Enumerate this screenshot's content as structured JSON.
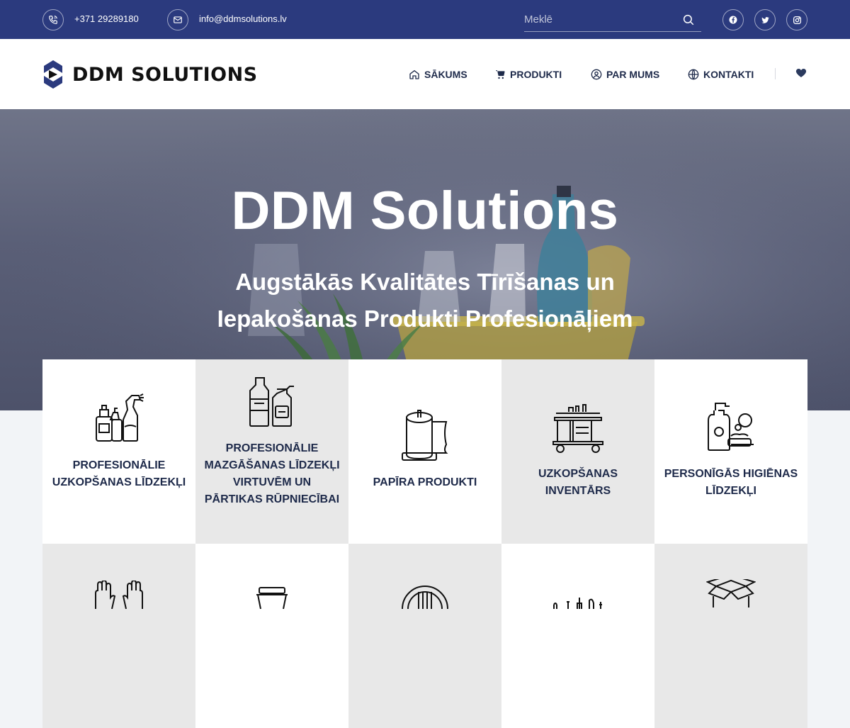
{
  "topbar": {
    "phone": "+371 29289180",
    "email": "info@ddmsolutions.lv",
    "search_placeholder": "Meklē",
    "social": [
      "facebook-icon",
      "twitter-icon",
      "instagram-icon"
    ]
  },
  "header": {
    "logo_text": "DDM SOLUTIONS",
    "nav": [
      {
        "label": "SĀKUMS",
        "icon": "home-icon"
      },
      {
        "label": "PRODUKTI",
        "icon": "cart-icon"
      },
      {
        "label": "PAR MUMS",
        "icon": "user-icon"
      },
      {
        "label": "KONTAKTI",
        "icon": "globe-icon"
      }
    ],
    "wishlist_icon": "heart-icon"
  },
  "hero": {
    "title": "DDM Solutions",
    "subtitle_line1": "Augstākās Kvalitātes Tīrīšanas un",
    "subtitle_line2": "Iepakošanas Produkti Profesionāļiem"
  },
  "categories": [
    {
      "label": "PROFESIONĀLIE UZKOPŠANAS LĪDZEKĻI",
      "icon": "cleaning-products-icon"
    },
    {
      "label": "PROFESIONĀLIE MAZGĀŠANAS LĪDZEKĻI VIRTUVĒM UN PĀRTIKAS RŪPNIECĪBAI",
      "icon": "kitchen-detergents-icon"
    },
    {
      "label": "PAPĪRA PRODUKTI",
      "icon": "paper-roll-icon"
    },
    {
      "label": "UZKOPŠANAS INVENTĀRS",
      "icon": "cleaning-cart-icon"
    },
    {
      "label": "PERSONĪGĀS HIGIĒNAS LĪDZEKĻI",
      "icon": "soap-dispenser-icon"
    },
    {
      "label": "",
      "icon": "gloves-icon"
    },
    {
      "label": "",
      "icon": "container-icon"
    },
    {
      "label": "",
      "icon": "plate-cutlery-icon"
    },
    {
      "label": "",
      "icon": "kitchen-utensils-icon"
    },
    {
      "label": "",
      "icon": "box-icon"
    }
  ],
  "colors": {
    "topbar": "#2b3a7e",
    "accent": "#1e2a4a",
    "card_grey": "#e8e8e8"
  }
}
